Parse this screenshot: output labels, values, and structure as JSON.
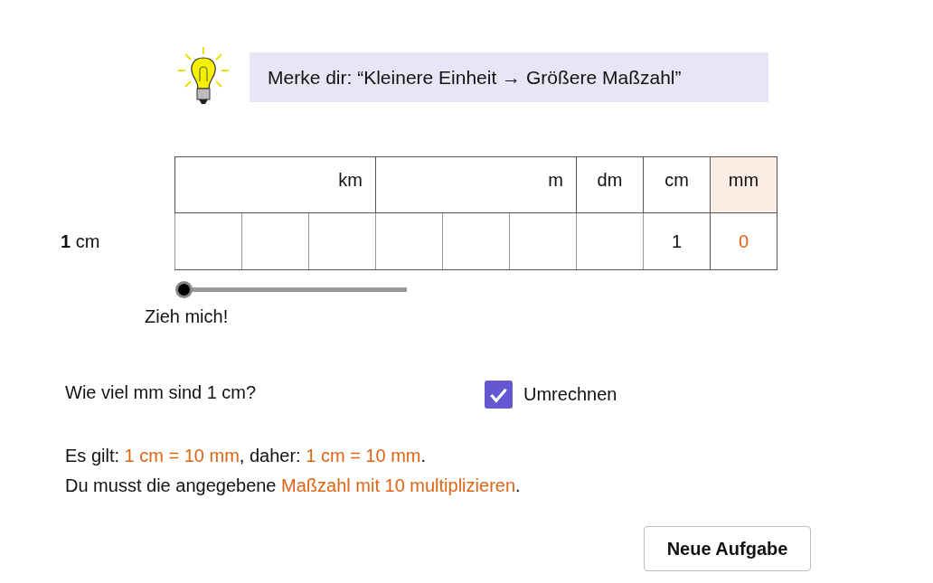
{
  "memo": "Merke dir: “Kleinere Einheit → Größere Maßzahl”",
  "table": {
    "units": [
      {
        "label": "km",
        "kind": "triple",
        "highlighted": false
      },
      {
        "label": "m",
        "kind": "triple",
        "highlighted": false
      },
      {
        "label": "dm",
        "kind": "single",
        "highlighted": false
      },
      {
        "label": "cm",
        "kind": "single",
        "highlighted": false
      },
      {
        "label": "mm",
        "kind": "single",
        "highlighted": true
      }
    ],
    "row_label": "**1** cm",
    "cells": [
      {},
      {},
      {},
      {},
      {},
      {},
      {},
      {
        "value": "1",
        "highlight": false
      },
      {
        "value": "0",
        "highlight": true
      }
    ]
  },
  "slider": {
    "level": 0,
    "label": "Zieh mich!"
  },
  "question": "Wie viel mm sind 1 cm?",
  "checkbox": {
    "label": "Umrechnen",
    "checked": true
  },
  "explanation": [
    [
      {
        "text": "Es gilt: ",
        "highlight": false
      },
      {
        "text": "1 cm = 10 mm",
        "highlight": true
      },
      {
        "text": ", daher: ",
        "highlight": false
      },
      {
        "text": "1 cm = 10 mm",
        "highlight": true
      },
      {
        "text": ".",
        "highlight": false
      }
    ],
    [
      {
        "text": "Du musst die angegebene ",
        "highlight": false
      },
      {
        "text": "Maßzahl mit 10 multiplizieren",
        "highlight": true
      },
      {
        "text": ".",
        "highlight": false
      }
    ]
  ],
  "button": "Neue Aufgabe"
}
